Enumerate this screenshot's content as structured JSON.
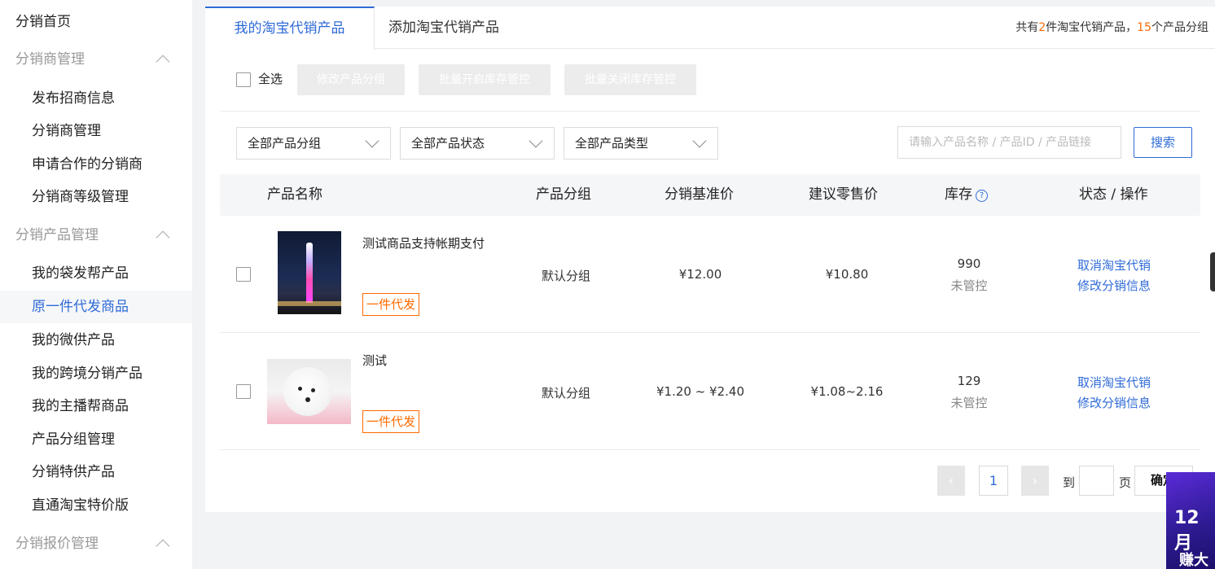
{
  "sidebar": {
    "home": "分销首页",
    "groups": [
      {
        "label": "分销商管理",
        "items": [
          "发布招商信息",
          "分销商管理",
          "申请合作的分销商",
          "分销商等级管理"
        ]
      },
      {
        "label": "分销产品管理",
        "items": [
          "我的袋发帮产品",
          "原一件代发商品",
          "我的微供产品",
          "我的跨境分销产品",
          "我的主播帮商品",
          "产品分组管理",
          "分销特供产品",
          "直通淘宝特价版"
        ]
      },
      {
        "label": "分销报价管理",
        "items": []
      }
    ]
  },
  "tabs": {
    "active": "我的淘宝代销产品",
    "other": "添加淘宝代销产品",
    "summary_pre": "共有",
    "summary_count": "2",
    "summary_mid": "件淘宝代销产品，",
    "summary_groups": "15",
    "summary_post": "个产品分组"
  },
  "actions": {
    "select_all": "全选",
    "btn_group": "修改产品分组",
    "btn_enable": "批量开启库存管控",
    "btn_disable": "批量关闭库存管控"
  },
  "filters": {
    "group": "全部产品分组",
    "status": "全部产品状态",
    "type": "全部产品类型",
    "search_placeholder": "请输入产品名称 / 产品ID / 产品链接",
    "search_button": "搜索"
  },
  "table": {
    "headers": {
      "name": "产品名称",
      "group": "产品分组",
      "base_price": "分销基准价",
      "retail_price": "建议零售价",
      "stock": "库存",
      "status": "状态 / 操作",
      "help": "?"
    },
    "rows": [
      {
        "name": "测试商品支持帐期支付",
        "tag": "一件代发",
        "group": "默认分组",
        "base_price": "¥12.00",
        "retail_price": "¥10.80",
        "stock": "990",
        "stock_status": "未管控",
        "action1": "取消淘宝代销",
        "action2": "修改分销信息"
      },
      {
        "name": "测试",
        "tag": "一件代发",
        "group": "默认分组",
        "base_price": "¥1.20 ~ ¥2.40",
        "retail_price": "¥1.08~2.16",
        "stock": "129",
        "stock_status": "未管控",
        "action1": "取消淘宝代销",
        "action2": "修改分销信息"
      }
    ]
  },
  "pagination": {
    "prev": "‹",
    "current": "1",
    "next": "›",
    "goto": "到",
    "page": "页",
    "confirm": "确定"
  },
  "promo": {
    "line1": "12月",
    "line2": "赚大"
  },
  "colors": {
    "accent": "#2f6bd7",
    "orange": "#ff6a00"
  }
}
